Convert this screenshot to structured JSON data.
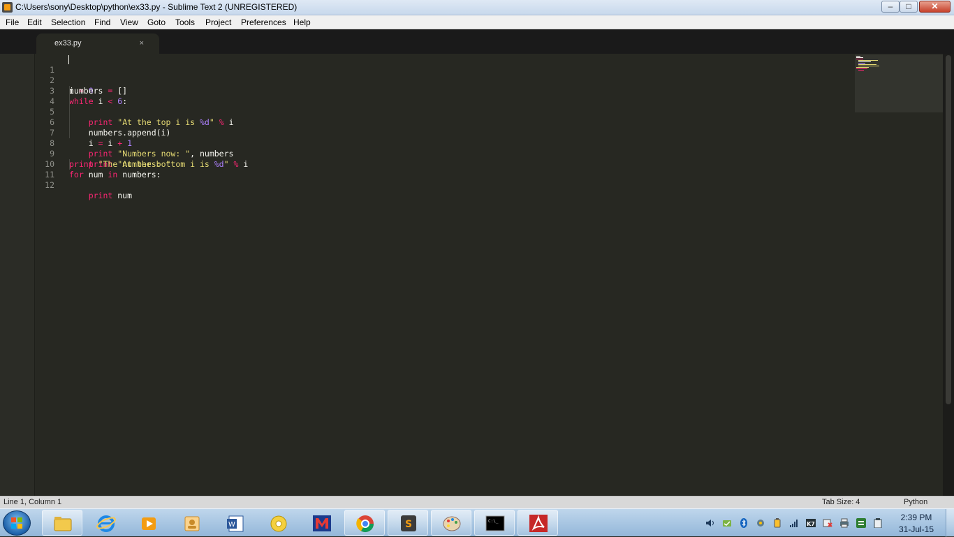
{
  "window": {
    "title": "C:\\Users\\sony\\Desktop\\python\\ex33.py - Sublime Text 2 (UNREGISTERED)",
    "controls": {
      "minimize": "–",
      "maximize": "□",
      "close": "✕"
    }
  },
  "menu": [
    "File",
    "Edit",
    "Selection",
    "Find",
    "View",
    "Goto",
    "Tools",
    "Project",
    "Preferences",
    "Help"
  ],
  "tab": {
    "label": "ex33.py",
    "close": "×"
  },
  "line_numbers": [
    "1",
    "2",
    "3",
    "4",
    "5",
    "6",
    "7",
    "8",
    "9",
    "10",
    "11",
    "12"
  ],
  "status": {
    "position": "Line 1, Column 1",
    "tab_size": "Tab Size: 4",
    "syntax": "Python"
  },
  "clock": {
    "time": "2:39 PM",
    "date": "31-Jul-15"
  },
  "taskbar": {
    "apps": [
      "windows-explorer",
      "internet-explorer",
      "media-player",
      "folder-app",
      "word",
      "disc-app",
      "mcafee",
      "chrome",
      "sublime-text",
      "paint",
      "command-prompt",
      "acrobat"
    ],
    "tray_icons": [
      "volume",
      "sync",
      "bluetooth",
      "network-settings",
      "power",
      "signal",
      "k7-antivirus",
      "disconnected",
      "printer",
      "green-app",
      "clipboard"
    ]
  },
  "colors": {
    "editor_bg": "#272822",
    "keyword": "#f92672",
    "number": "#ae81ff",
    "string": "#e6db74",
    "text": "#f8f8f2",
    "gutter": "#8f908a"
  }
}
